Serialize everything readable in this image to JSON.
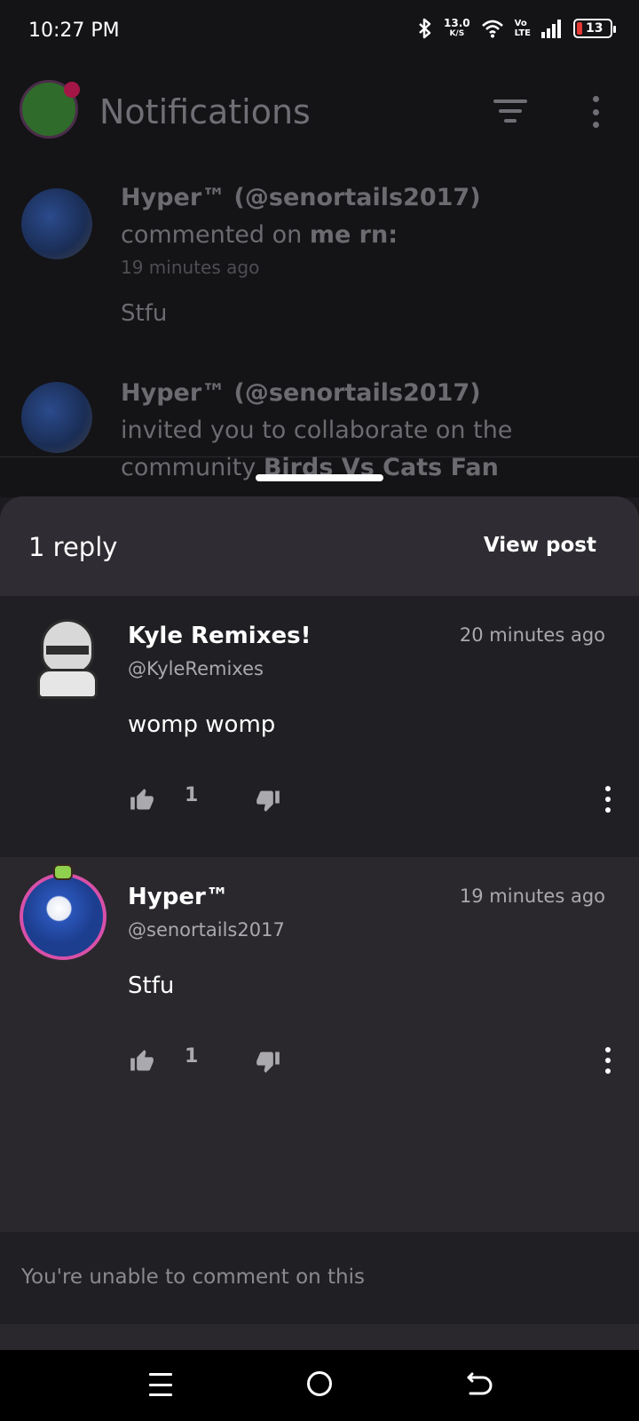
{
  "status_bar": {
    "time": "10:27 PM",
    "net_speed": "13.0",
    "net_speed_unit": "K/S",
    "volte_top": "Vo",
    "volte_bottom": "LTE",
    "battery": "13"
  },
  "background": {
    "title": "Notifications",
    "notifications": [
      {
        "actor": "Hyper™ (@senortails2017)",
        "action": "commented on ",
        "target": "me rn:",
        "time": "19 minutes ago",
        "body": "Stfu"
      },
      {
        "actor": "Hyper™ (@senortails2017)",
        "action": "invited you to collaborate on the community ",
        "target": "Birds Vs Cats Fan"
      }
    ]
  },
  "sheet": {
    "reply_count": "1 reply",
    "view_post": "View post",
    "comments": [
      {
        "name": "Kyle Remixes!",
        "handle": "@KyleRemixes",
        "time": "20 minutes ago",
        "text": "womp womp",
        "likes": "1"
      },
      {
        "name": "Hyper™",
        "handle": "@senortails2017",
        "time": "19 minutes ago",
        "text": "Stfu",
        "likes": "1"
      }
    ],
    "footer": "You're unable to comment on this"
  },
  "colors": {
    "sheet_bg": "#2a282d",
    "accent_ring": "#d850a8",
    "battery_low": "#e53935"
  }
}
